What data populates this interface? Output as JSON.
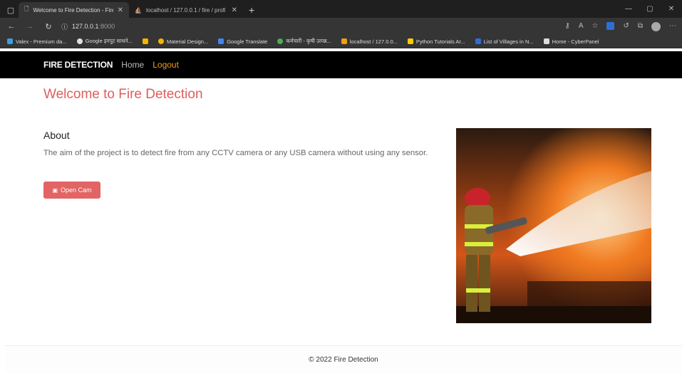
{
  "browser": {
    "tabs": [
      {
        "title": "Welcome to Fire Detection - Fire",
        "active": true
      },
      {
        "title": "localhost / 127.0.0.1 / fire / profi",
        "active": false
      }
    ],
    "url": "127.0.0.1",
    "url_port": ":8000",
    "bookmarks": [
      {
        "label": "Valex - Premium da...",
        "color": "#3aa0e0"
      },
      {
        "label": "Google इनपुट साधने...",
        "color": "#e0e0e0"
      },
      {
        "label": "",
        "color": "#f5b400"
      },
      {
        "label": "Material Design...",
        "color": "#f5b400"
      },
      {
        "label": "Google Translate",
        "color": "#4285f4"
      },
      {
        "label": "कर्मचारी - कृषी उत्पन्न...",
        "color": "#4caf50"
      },
      {
        "label": "localhost / 127.0.0...",
        "color": "#f39c12"
      },
      {
        "label": "Python Tutorials Ar...",
        "color": "#ffcc00"
      },
      {
        "label": "List of Villages in N...",
        "color": "#2d6fd6"
      },
      {
        "label": "Home - CyberPanel",
        "color": "#dddddd"
      }
    ]
  },
  "nav": {
    "brand": "FIRE DETECTION",
    "home": "Home",
    "logout": "Logout"
  },
  "main": {
    "title": "Welcome to Fire Detection",
    "about_heading": "About",
    "about_text": "The aim of the project is to detect fire from any CCTV camera or any USB camera without using any sensor.",
    "open_cam_label": "Open Cam"
  },
  "footer": {
    "text": "© 2022 Fire Detection"
  },
  "colors": {
    "accent": "#e05d5d",
    "button": "#e36464",
    "logout": "#f39c12"
  }
}
